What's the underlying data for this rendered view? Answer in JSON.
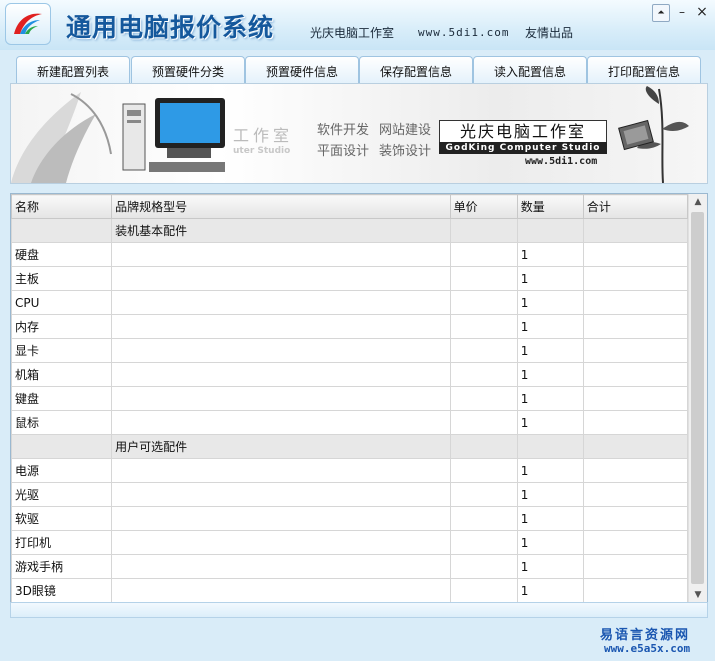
{
  "window": {
    "title": "通用电脑报价系统",
    "studio": "光庆电脑工作室",
    "website": "www.5di1.com",
    "credit": "友情出品",
    "controls": {
      "restore": "⏶",
      "minimize": "–",
      "close": "×"
    }
  },
  "tabs": [
    "新建配置列表",
    "预置硬件分类",
    "预置硬件信息",
    "保存配置信息",
    "读入配置信息",
    "打印配置信息"
  ],
  "banner": {
    "ghost_text": "工作室",
    "ghost_sub": "uter Studio",
    "service_1": "软件开发",
    "service_2": "网站建设",
    "service_3": "平面设计",
    "service_4": "装饰设计",
    "box_title": "光庆电脑工作室",
    "box_sub": "GodKing Computer Studio",
    "url": "www.5di1.com"
  },
  "table": {
    "headers": [
      "名称",
      "品牌规格型号",
      "单价",
      "数量",
      "合计"
    ],
    "rows": [
      {
        "group": true,
        "name": "",
        "spec": "装机基本配件",
        "price": "",
        "qty": "",
        "total": ""
      },
      {
        "name": "硬盘",
        "spec": "",
        "price": "",
        "qty": "1",
        "total": ""
      },
      {
        "name": "主板",
        "spec": "",
        "price": "",
        "qty": "1",
        "total": ""
      },
      {
        "name": "CPU",
        "spec": "",
        "price": "",
        "qty": "1",
        "total": ""
      },
      {
        "name": "内存",
        "spec": "",
        "price": "",
        "qty": "1",
        "total": ""
      },
      {
        "name": "显卡",
        "spec": "",
        "price": "",
        "qty": "1",
        "total": ""
      },
      {
        "name": "机箱",
        "spec": "",
        "price": "",
        "qty": "1",
        "total": ""
      },
      {
        "name": "键盘",
        "spec": "",
        "price": "",
        "qty": "1",
        "total": ""
      },
      {
        "name": "鼠标",
        "spec": "",
        "price": "",
        "qty": "1",
        "total": ""
      },
      {
        "group": true,
        "name": "",
        "spec": "用户可选配件",
        "price": "",
        "qty": "",
        "total": ""
      },
      {
        "name": "电源",
        "spec": "",
        "price": "",
        "qty": "1",
        "total": ""
      },
      {
        "name": "光驱",
        "spec": "",
        "price": "",
        "qty": "1",
        "total": ""
      },
      {
        "name": "软驱",
        "spec": "",
        "price": "",
        "qty": "1",
        "total": ""
      },
      {
        "name": "打印机",
        "spec": "",
        "price": "",
        "qty": "1",
        "total": ""
      },
      {
        "name": "游戏手柄",
        "spec": "",
        "price": "",
        "qty": "1",
        "total": ""
      },
      {
        "name": "3D眼镜",
        "spec": "",
        "price": "",
        "qty": "1",
        "total": ""
      }
    ]
  },
  "scrollbar": {
    "up": "▲",
    "down": "▼"
  },
  "watermark": {
    "line1": "易语言资源网",
    "line2": "www.e5a5x.com"
  },
  "colors": {
    "title": "#15589c",
    "window_bg": "#d9ecf8",
    "tab_border": "#9fc4e1"
  }
}
